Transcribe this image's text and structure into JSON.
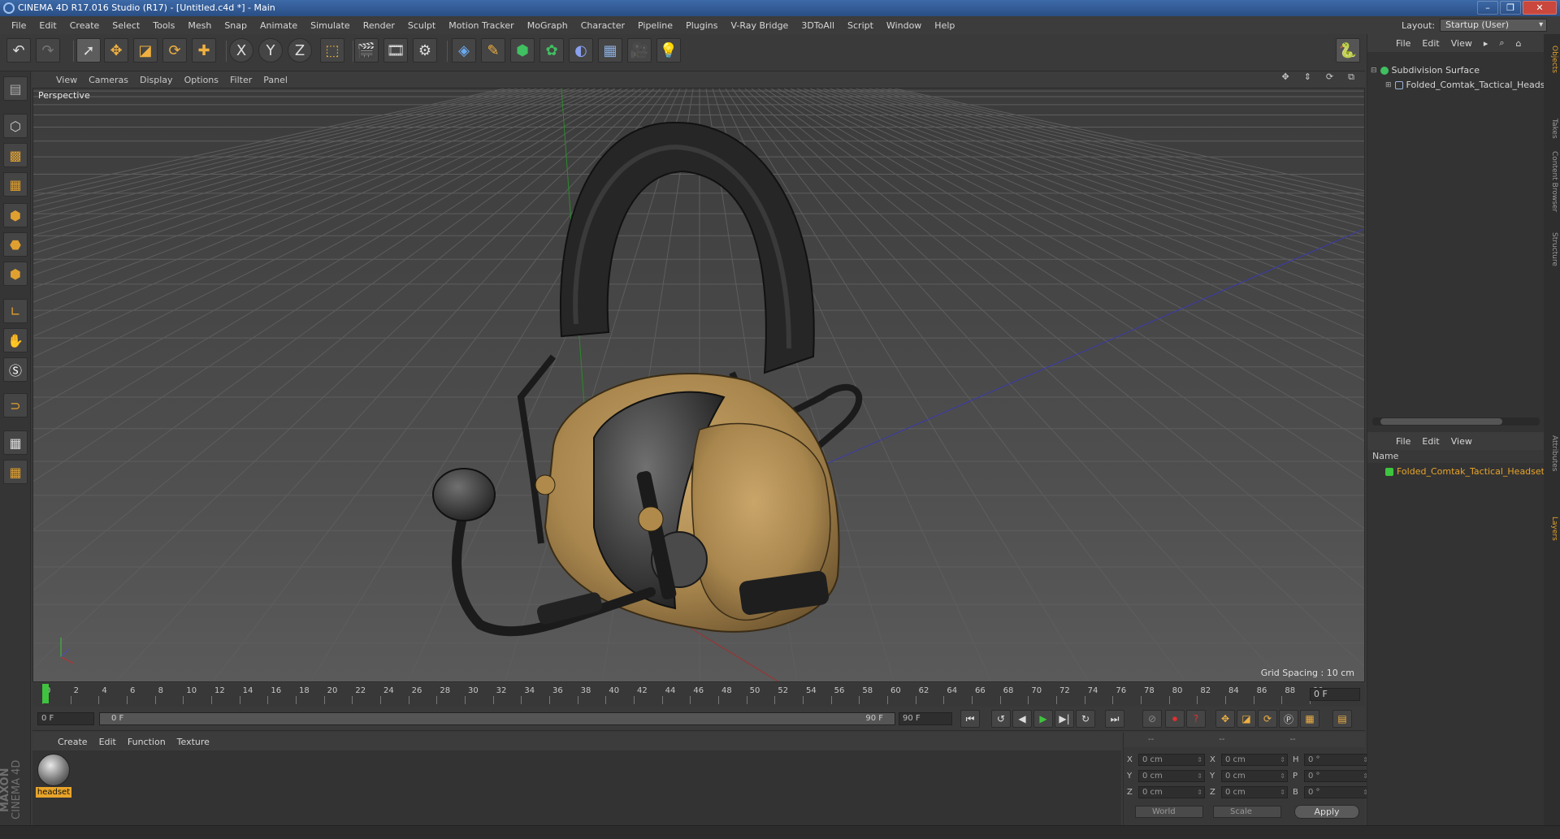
{
  "window": {
    "title": "CINEMA 4D R17.016 Studio (R17) - [Untitled.c4d *] - Main"
  },
  "menu": [
    "File",
    "Edit",
    "Create",
    "Select",
    "Tools",
    "Mesh",
    "Snap",
    "Animate",
    "Simulate",
    "Render",
    "Sculpt",
    "Motion Tracker",
    "MoGraph",
    "Character",
    "Pipeline",
    "Plugins",
    "V-Ray Bridge",
    "3DToAll",
    "Script",
    "Window",
    "Help"
  ],
  "layout": {
    "label": "Layout:",
    "value": "Startup (User)"
  },
  "toolbar": {
    "icons": [
      "undo-icon",
      "redo-icon",
      "select-arrow-icon",
      "move-icon",
      "scale-icon",
      "rotate-icon",
      "add-icon",
      "axis-x-icon",
      "axis-y-icon",
      "axis-z-icon",
      "coordinate-system-icon",
      "render-view-icon",
      "render-picture-viewer-icon",
      "edit-render-settings-icon",
      "cube-icon",
      "pen-spline-icon",
      "subdivision-icon",
      "array-icon",
      "deformer-icon",
      "floor-icon",
      "camera-icon",
      "light-icon"
    ],
    "axis_labels": [
      "X",
      "Y",
      "Z"
    ]
  },
  "viewport": {
    "menu": [
      "View",
      "Cameras",
      "Display",
      "Options",
      "Filter",
      "Panel"
    ],
    "label": "Perspective",
    "grid_spacing": "Grid Spacing : 10 cm"
  },
  "timeline": {
    "ticks": [
      "0",
      "2",
      "4",
      "6",
      "8",
      "10",
      "12",
      "14",
      "16",
      "18",
      "20",
      "22",
      "24",
      "26",
      "28",
      "30",
      "32",
      "34",
      "36",
      "38",
      "40",
      "42",
      "44",
      "46",
      "48",
      "50",
      "52",
      "54",
      "56",
      "58",
      "60",
      "62",
      "64",
      "66",
      "68",
      "70",
      "72",
      "74",
      "76",
      "78",
      "80",
      "82",
      "84",
      "86",
      "88",
      "90"
    ],
    "current_frame": "0 F",
    "playhead_fraction": 0
  },
  "transport": {
    "start_field": "0 F",
    "range_start": "0 F",
    "range_end": "90 F",
    "end_field": "90 F"
  },
  "material_manager": {
    "menu": [
      "Create",
      "Edit",
      "Function",
      "Texture"
    ],
    "materials": [
      {
        "name": "headset"
      }
    ]
  },
  "coordinates": {
    "headers": [
      "--",
      "--",
      "--"
    ],
    "rows": [
      {
        "a1": "X",
        "v1": "0 cm",
        "a2": "X",
        "v2": "0 cm",
        "a3": "H",
        "v3": "0 °"
      },
      {
        "a1": "Y",
        "v1": "0 cm",
        "a2": "Y",
        "v2": "0 cm",
        "a3": "P",
        "v3": "0 °"
      },
      {
        "a1": "Z",
        "v1": "0 cm",
        "a2": "Z",
        "v2": "0 cm",
        "a3": "B",
        "v3": "0 °"
      }
    ],
    "mode": "World",
    "transform": "Scale",
    "apply_label": "Apply"
  },
  "object_manager": {
    "menu": [
      "File",
      "Edit",
      "View"
    ],
    "objects": [
      {
        "name": "Subdivision Surface"
      },
      {
        "name": "Folded_Comtak_Tactical_Headset"
      }
    ]
  },
  "layer_manager": {
    "menu": [
      "File",
      "Edit",
      "View"
    ],
    "column": "Name",
    "layers": [
      {
        "name": "Folded_Comtak_Tactical_Headset_",
        "color": "#3ec43e"
      }
    ]
  },
  "side_tabs": [
    "Objects",
    "Takes",
    "Content Browser",
    "Structure",
    "Attributes",
    "Layers"
  ],
  "logo": {
    "brand": "MAXON",
    "product": "CINEMA 4D"
  },
  "colors": {
    "accent": "#e8a42a",
    "playhead": "#3ec43e",
    "titlebar": "#2a4e85"
  }
}
